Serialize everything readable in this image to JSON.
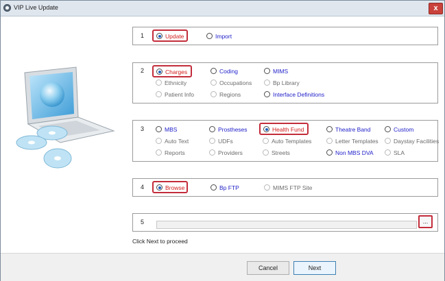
{
  "window": {
    "title": "VIP Live Update",
    "close_label": "x"
  },
  "groups": [
    {
      "number": "1",
      "options": [
        {
          "label": "Update",
          "selected": true,
          "highlight": true,
          "disabled": false
        },
        {
          "label": "Import",
          "selected": false,
          "highlight": false,
          "disabled": false
        }
      ]
    },
    {
      "number": "2",
      "options": [
        {
          "label": "Charges",
          "selected": true,
          "highlight": true,
          "disabled": false
        },
        {
          "label": "Coding",
          "selected": false,
          "highlight": false,
          "disabled": false
        },
        {
          "label": "MIMS",
          "selected": false,
          "highlight": false,
          "disabled": false
        },
        {
          "label": "Ethnicity",
          "selected": false,
          "highlight": false,
          "disabled": true
        },
        {
          "label": "Occupations",
          "selected": false,
          "highlight": false,
          "disabled": true
        },
        {
          "label": "Bp Library",
          "selected": false,
          "highlight": false,
          "disabled": true
        },
        {
          "label": "Patient Info",
          "selected": false,
          "highlight": false,
          "disabled": true
        },
        {
          "label": "Regions",
          "selected": false,
          "highlight": false,
          "disabled": true
        },
        {
          "label": "Interface Definitions",
          "selected": false,
          "highlight": false,
          "disabled": false
        }
      ]
    },
    {
      "number": "3",
      "options": [
        {
          "label": "MBS",
          "selected": false,
          "highlight": false,
          "disabled": false
        },
        {
          "label": "Prostheses",
          "selected": false,
          "highlight": false,
          "disabled": false
        },
        {
          "label": "Health Fund",
          "selected": true,
          "highlight": true,
          "disabled": false
        },
        {
          "label": "Theatre Band",
          "selected": false,
          "highlight": false,
          "disabled": false
        },
        {
          "label": "Custom",
          "selected": false,
          "highlight": false,
          "disabled": false
        },
        {
          "label": "Auto Text",
          "selected": false,
          "highlight": false,
          "disabled": true
        },
        {
          "label": "UDFs",
          "selected": false,
          "highlight": false,
          "disabled": true
        },
        {
          "label": "Auto Templates",
          "selected": false,
          "highlight": false,
          "disabled": true
        },
        {
          "label": "Letter Templates",
          "selected": false,
          "highlight": false,
          "disabled": true
        },
        {
          "label": "Daystay Facilities",
          "selected": false,
          "highlight": false,
          "disabled": true
        },
        {
          "label": "Reports",
          "selected": false,
          "highlight": false,
          "disabled": true
        },
        {
          "label": "Providers",
          "selected": false,
          "highlight": false,
          "disabled": true
        },
        {
          "label": "Streets",
          "selected": false,
          "highlight": false,
          "disabled": true
        },
        {
          "label": "Non MBS DVA",
          "selected": false,
          "highlight": false,
          "disabled": false
        },
        {
          "label": "SLA",
          "selected": false,
          "highlight": false,
          "disabled": true
        }
      ]
    },
    {
      "number": "4",
      "options": [
        {
          "label": "Browse",
          "selected": true,
          "highlight": true,
          "disabled": false
        },
        {
          "label": "Bp FTP",
          "selected": false,
          "highlight": false,
          "disabled": false
        },
        {
          "label": "MIMS FTP Site",
          "selected": false,
          "highlight": false,
          "disabled": true
        }
      ]
    },
    {
      "number": "5",
      "path_value": "",
      "browse_label": "..."
    }
  ],
  "hint": "Click Next to proceed",
  "footer": {
    "cancel_label": "Cancel",
    "next_label": "Next"
  },
  "icons": {
    "app": "app-icon",
    "close": "close-icon",
    "illustration": "laptop-globe-illustration"
  },
  "colors": {
    "highlight_border": "#c32c3a",
    "link_blue": "#1d1dc9",
    "selected_red": "#d21a1a",
    "close_red": "#c9423b"
  }
}
